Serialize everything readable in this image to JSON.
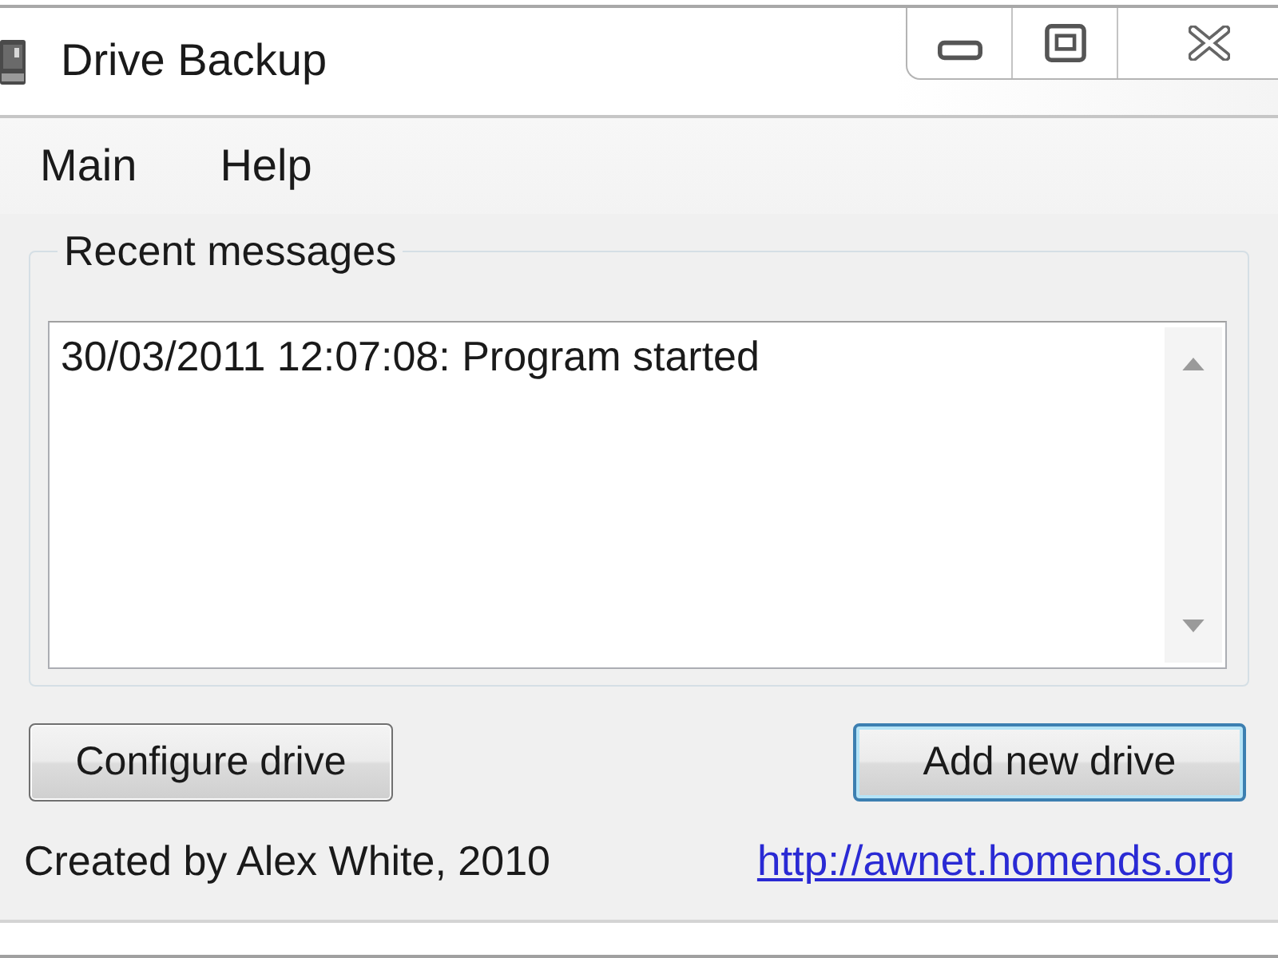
{
  "window": {
    "title": "Drive Backup"
  },
  "menu": [
    {
      "label": "Main"
    },
    {
      "label": "Help"
    }
  ],
  "messages_group": {
    "title": "Recent messages",
    "messages": [
      "30/03/2011 12:07:08: Program started"
    ]
  },
  "buttons": [
    {
      "label": "Configure drive",
      "default": false
    },
    {
      "label": "Add new drive",
      "default": true
    }
  ],
  "footer": {
    "credit": "Created by Alex White, 2010",
    "link": "http://awnet.homends.org"
  }
}
